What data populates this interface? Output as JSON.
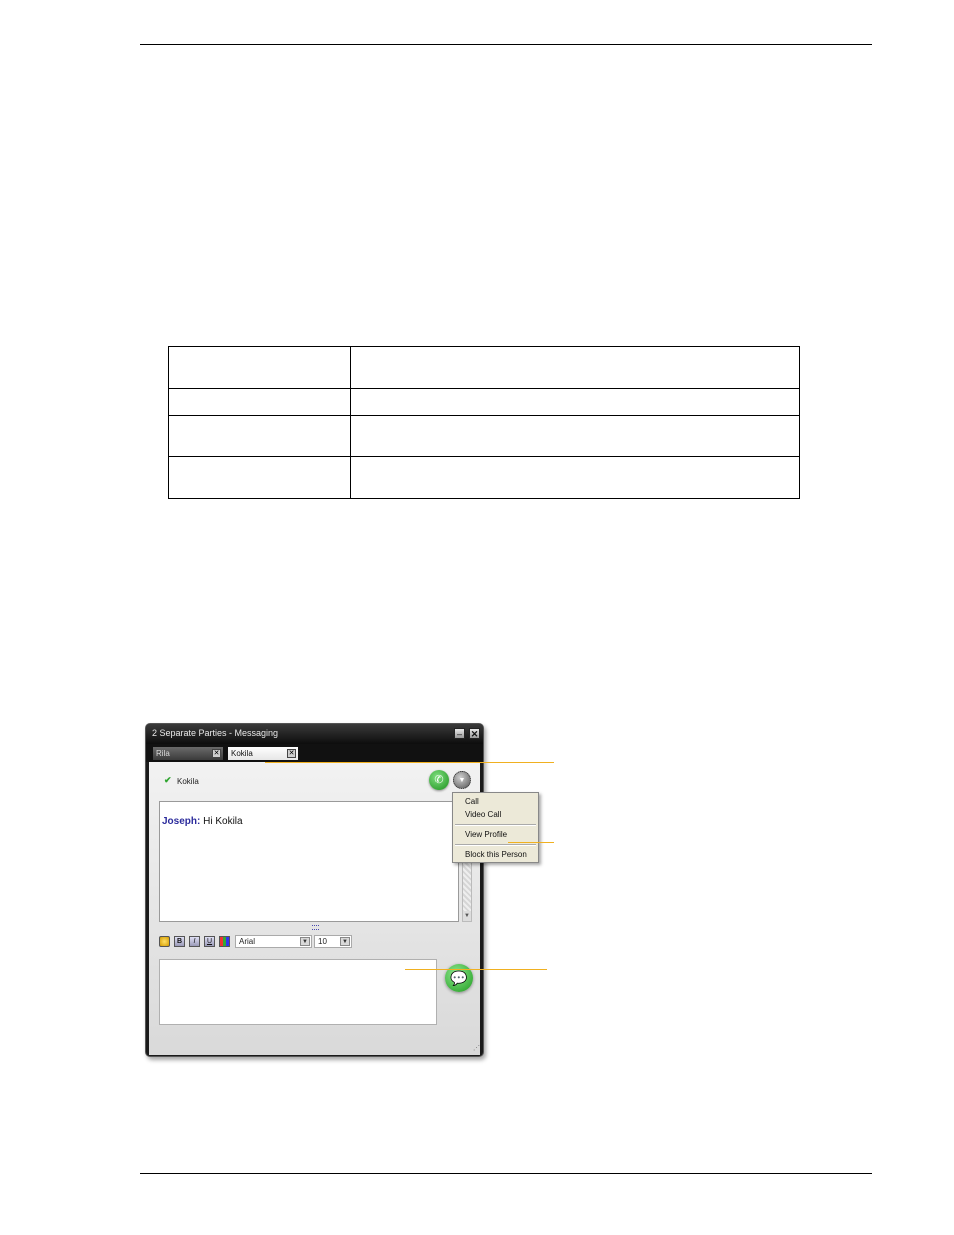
{
  "window": {
    "title": "2 Separate Parties - Messaging",
    "minimize_glyph": "–",
    "close_glyph": "✕",
    "tabs": [
      {
        "label": "Rila",
        "close_glyph": "✕"
      },
      {
        "label": "Kokila",
        "close_glyph": "✕"
      }
    ],
    "contact": {
      "name": "Kokila",
      "status_icon": "check-icon"
    },
    "call_icon": "✆",
    "more_icon": "▼",
    "message": {
      "sender": "Joseph:",
      "text": " Hi Kokila"
    },
    "scroll_down_glyph": "▼",
    "toolbar": {
      "bold": "B",
      "italic": "I",
      "underline": "U",
      "font": "Arial",
      "size": "10",
      "dd_arrow": "▼"
    },
    "send_icon": "💬",
    "resize_glyph": "⋰"
  },
  "context_menu": {
    "items": [
      "Call",
      "Video Call",
      "View Profile",
      "Block this Person"
    ]
  },
  "colors": {
    "callout_line": "#f0b020",
    "sender_name": "#2b2b9c"
  }
}
